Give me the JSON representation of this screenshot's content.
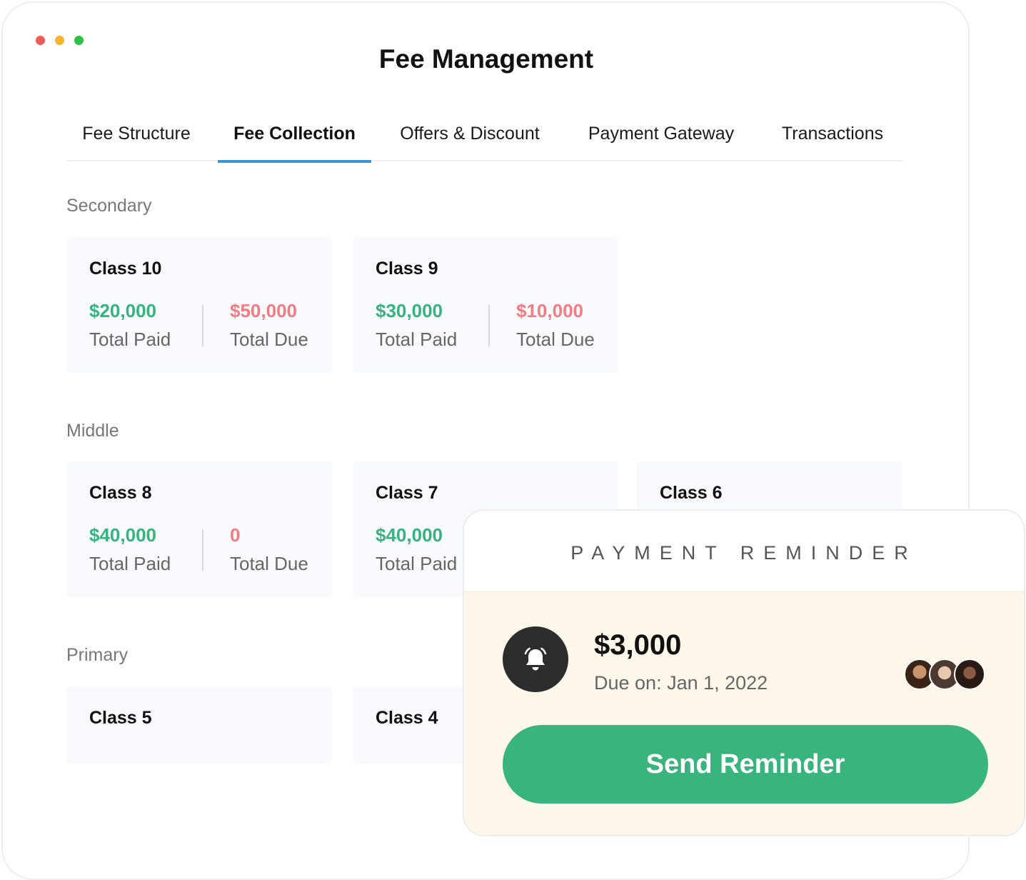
{
  "window": {
    "title": "Fee Management",
    "traffic_lights": [
      "#f05a55",
      "#f3b52b",
      "#2fc046"
    ]
  },
  "tabs": [
    {
      "label": "Fee Structure",
      "active": false
    },
    {
      "label": "Fee Collection",
      "active": true
    },
    {
      "label": "Offers & Discount",
      "active": false
    },
    {
      "label": "Payment Gateway",
      "active": false
    },
    {
      "label": "Transactions",
      "active": false
    }
  ],
  "sections": {
    "secondary": {
      "label": "Secondary",
      "classes": [
        {
          "name": "Class 10",
          "paid": "$20,000",
          "paid_label": "Total Paid",
          "due": "$50,000",
          "due_label": "Total Due"
        },
        {
          "name": "Class 9",
          "paid": "$30,000",
          "paid_label": "Total Paid",
          "due": "$10,000",
          "due_label": "Total Due"
        }
      ]
    },
    "middle": {
      "label": "Middle",
      "classes": [
        {
          "name": "Class 8",
          "paid": "$40,000",
          "paid_label": "Total Paid",
          "due": "0",
          "due_label": "Total Due"
        },
        {
          "name": "Class 7",
          "paid": "$40,000",
          "paid_label": "Total Paid"
        },
        {
          "name": "Class 6"
        }
      ]
    },
    "primary": {
      "label": "Primary",
      "classes": [
        {
          "name": "Class 5"
        },
        {
          "name": "Class 4"
        }
      ]
    }
  },
  "reminder": {
    "title": "PAYMENT REMINDER",
    "amount": "$3,000",
    "due_text": "Due on: Jan 1, 2022",
    "icon": "bell-icon",
    "button_label": "Send Reminder"
  },
  "colors": {
    "paid": "#36b37e",
    "due": "#f17d82",
    "tab_accent": "#3a96db",
    "button": "#38b47c",
    "reminder_bg": "#fdf7e9"
  }
}
